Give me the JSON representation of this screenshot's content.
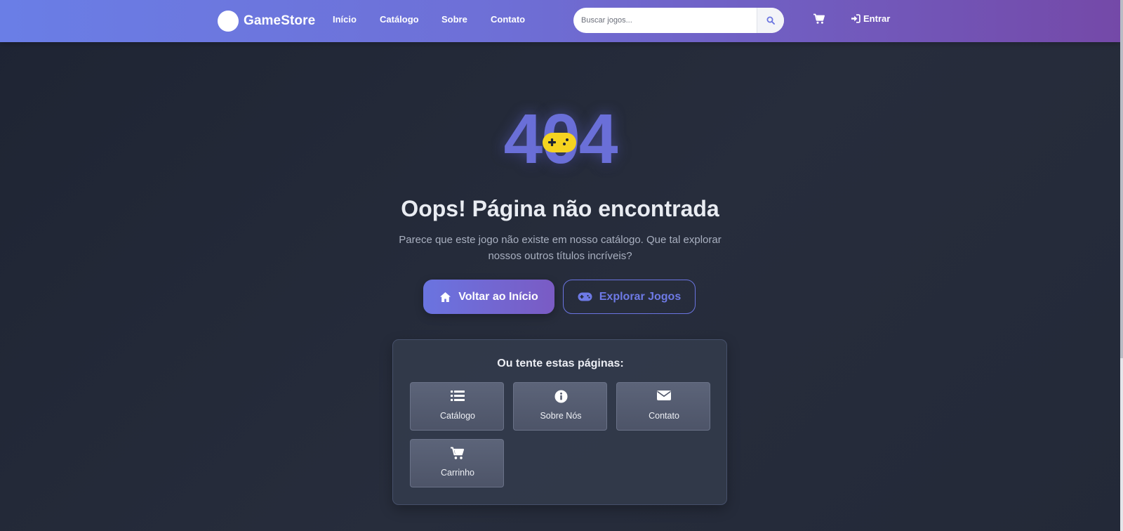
{
  "brand": {
    "name": "GameStore"
  },
  "nav": {
    "links": [
      "Início",
      "Catálogo",
      "Sobre",
      "Contato"
    ]
  },
  "search": {
    "placeholder": "Buscar jogos...",
    "value": ""
  },
  "account": {
    "login_label": "Entrar"
  },
  "error": {
    "code_left": "4",
    "code_middle": "0",
    "code_right": "4",
    "title": "Oops! Página não encontrada",
    "message": "Parece que este jogo não existe em nosso catálogo. Que tal explorar nossos outros títulos incríveis?"
  },
  "actions": {
    "primary_label": "Voltar ao Início",
    "secondary_label": "Explorar Jogos"
  },
  "suggestions": {
    "title": "Ou tente estas páginas:",
    "items": [
      {
        "label": "Catálogo",
        "icon": "list-icon"
      },
      {
        "label": "Sobre Nós",
        "icon": "info-icon"
      },
      {
        "label": "Contato",
        "icon": "envelope-icon"
      },
      {
        "label": "Carrinho",
        "icon": "cart-icon"
      }
    ]
  },
  "colors": {
    "nav_gradient_start": "#6a7ee6",
    "nav_gradient_end": "#7449a8",
    "accent": "#6a74e0",
    "gamepad_yellow": "#f5d320",
    "background": "#232938"
  }
}
